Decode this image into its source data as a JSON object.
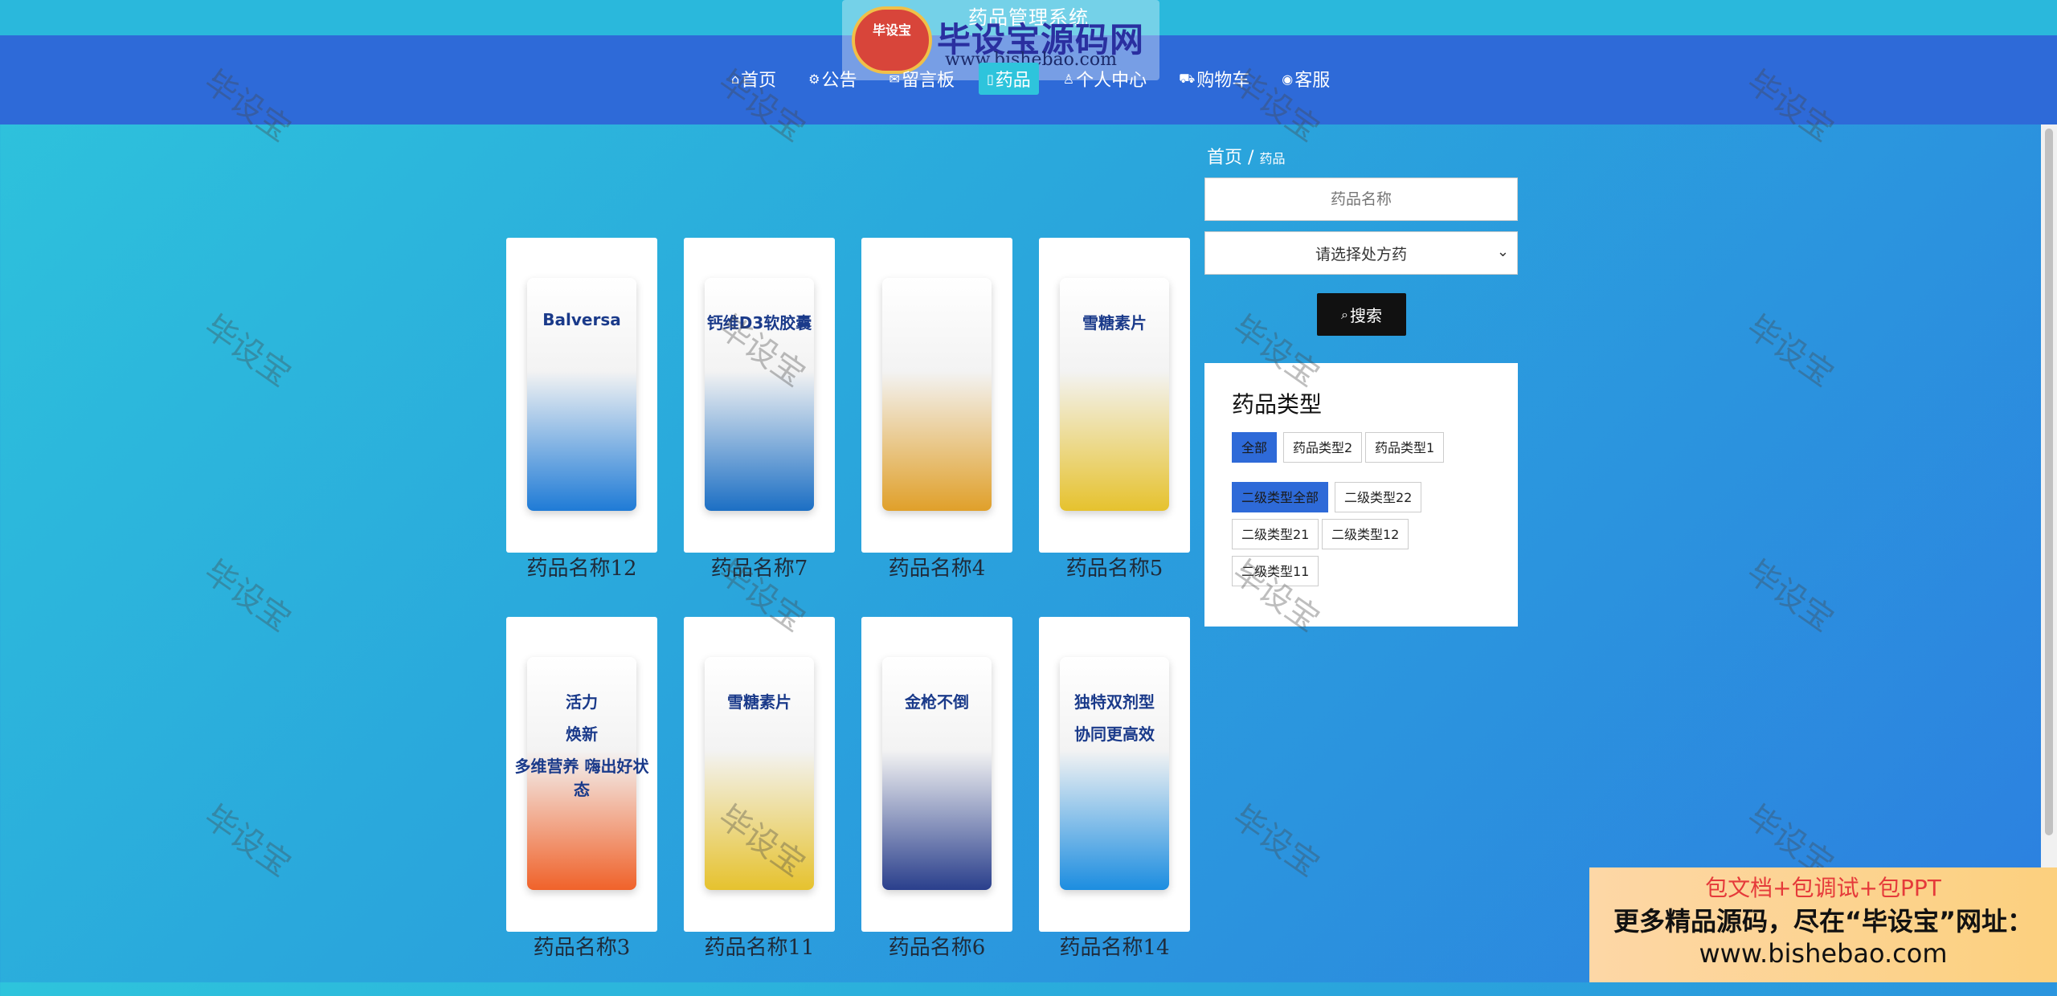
{
  "site": {
    "title": "药品管理系统"
  },
  "logo": {
    "badge": "毕设宝",
    "main": "毕设宝源码网",
    "url": "www.bishebao.com"
  },
  "nav": [
    {
      "icon": "home-icon",
      "glyph": "⌂",
      "label": "首页",
      "active": false
    },
    {
      "icon": "gear-icon",
      "glyph": "⚙",
      "label": "公告",
      "active": false
    },
    {
      "icon": "message-icon",
      "glyph": "✉",
      "label": "留言板",
      "active": false
    },
    {
      "icon": "document-icon",
      "glyph": "▯",
      "label": "药品",
      "active": true
    },
    {
      "icon": "user-icon",
      "glyph": "♙",
      "label": "个人中心",
      "active": false
    },
    {
      "icon": "cart-icon",
      "glyph": "⛟",
      "label": "购物车",
      "active": false
    },
    {
      "icon": "support-icon",
      "glyph": "◉",
      "label": "客服",
      "active": false
    }
  ],
  "breadcrumb": {
    "home": "首页",
    "sep": "/",
    "current": "药品"
  },
  "search": {
    "placeholder": "药品名称",
    "select_value": "请选择处方药",
    "button": "搜索"
  },
  "categories": {
    "title": "药品类型",
    "level1": [
      "全部",
      "药品类型2",
      "药品类型1"
    ],
    "level2": [
      "二级类型全部",
      "二级类型22",
      "二级类型21",
      "二级类型12",
      "二级类型11"
    ]
  },
  "products": [
    {
      "name": "药品名称12",
      "color": "#1f7bd6"
    },
    {
      "name": "药品名称7",
      "color": "#1c6fc4"
    },
    {
      "name": "药品名称4",
      "color": "#e0a02a"
    },
    {
      "name": "药品名称5",
      "color": "#e6c22e"
    },
    {
      "name": "药品名称3",
      "color": "#f0622a"
    },
    {
      "name": "药品名称11",
      "color": "#e6c22e"
    },
    {
      "name": "药品名称6",
      "color": "#2a3f8c"
    },
    {
      "name": "药品名称14",
      "color": "#1c8de0"
    }
  ],
  "product_labels": {
    "p12": "Balversa",
    "p7": "钙维D3软胶囊",
    "p5": "雪糖素片",
    "p3a": "活力",
    "p3b": "焕新",
    "p3c": "多维营养 嗨出好状态",
    "p11": "雪糖素片",
    "p6": "金枪不倒",
    "p14a": "独特双剂型",
    "p14b": "协同更高效"
  },
  "watermark": "毕设宝",
  "ad": {
    "line1": "包文档+包调试+包PPT",
    "line2": "更多精品源码，尽在“毕设宝”网址：",
    "line3": "www.bishebao.com"
  }
}
